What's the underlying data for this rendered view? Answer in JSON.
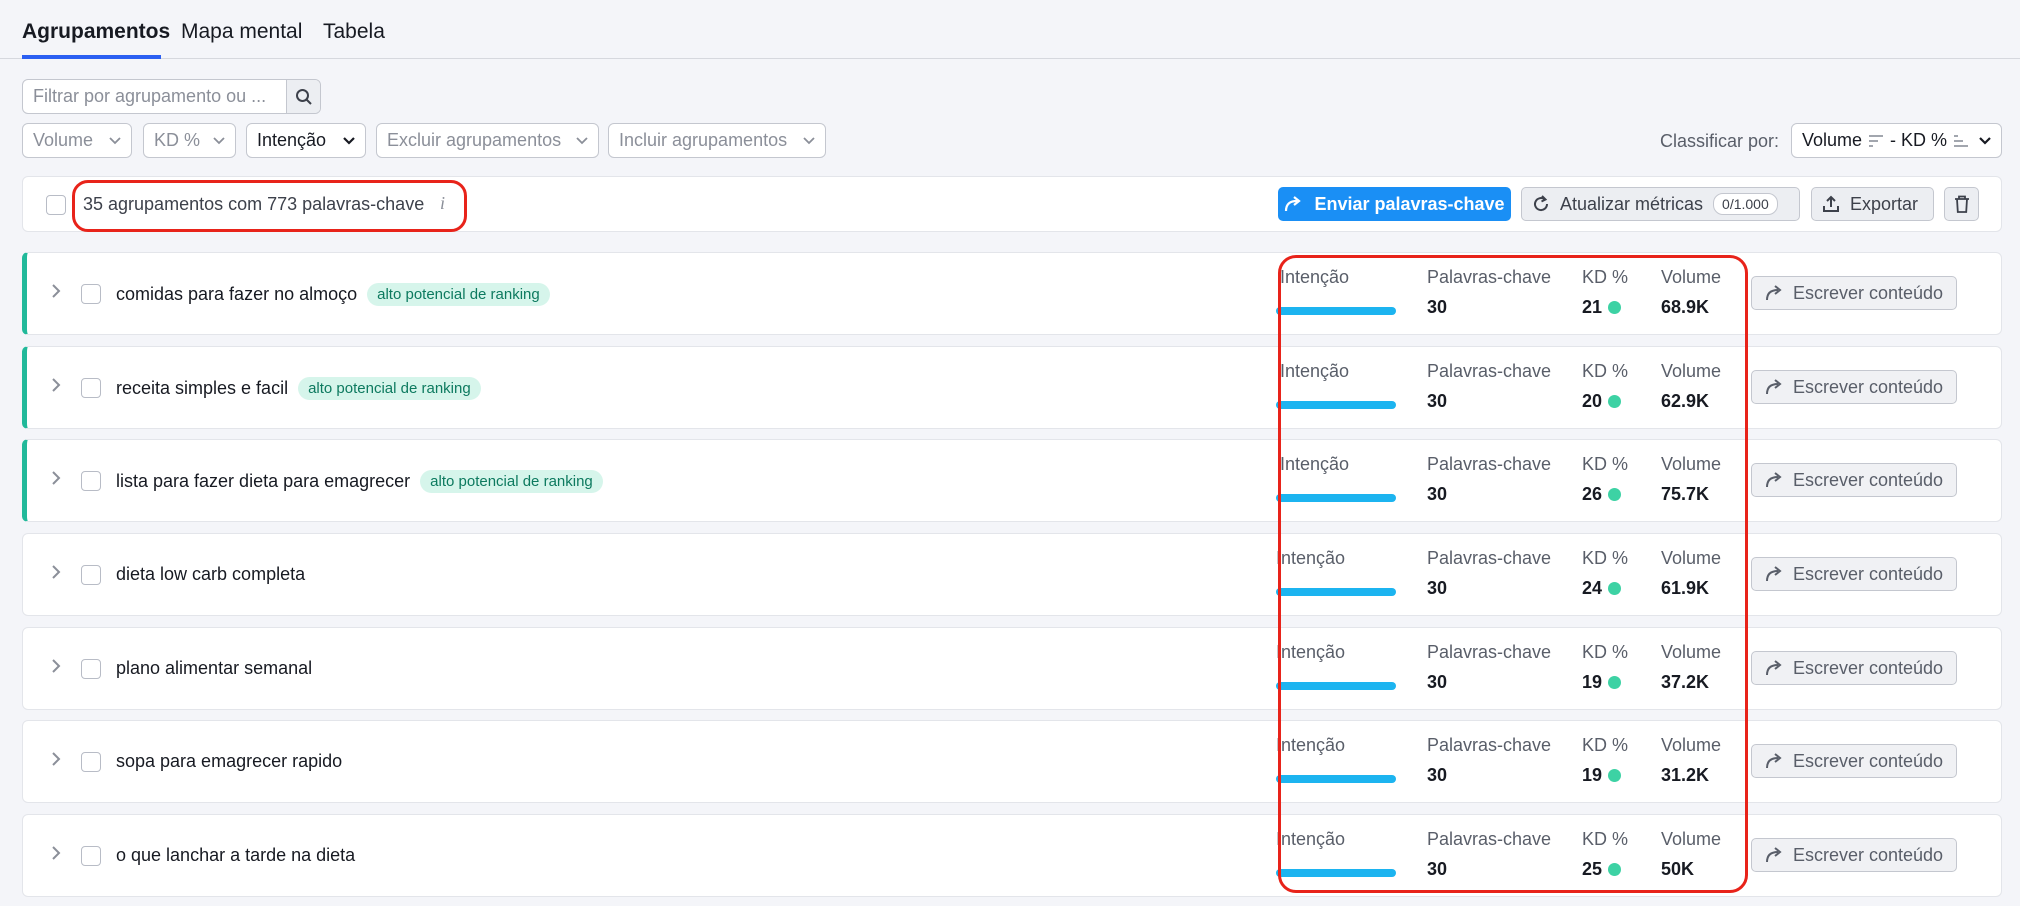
{
  "tabs": [
    "Agrupamentos",
    "Mapa mental",
    "Tabela"
  ],
  "filter": {
    "placeholder": "Filtrar por agrupamento ou ..."
  },
  "dropdowns": {
    "volume": "Volume",
    "kd": "KD %",
    "intencao": "Intenção",
    "excluir": "Excluir agrupamentos",
    "incluir": "Incluir agrupamentos"
  },
  "sort": {
    "label": "Classificar por:",
    "volume": "Volume",
    "sep": "- KD %"
  },
  "summary": {
    "text": "35 agrupamentos com 773 palavras-chave",
    "info": "i"
  },
  "actions": {
    "send": "Enviar palavras-chave",
    "update": "Atualizar métricas",
    "update_count": "0/1.000",
    "export": "Exportar"
  },
  "metric_labels": {
    "intent": "Intenção",
    "keywords": "Palavras-chave",
    "kd": "KD %",
    "volume": "Volume"
  },
  "write_label": "Escrever conteúdo",
  "badge_label": "alto potencial de ranking",
  "colors": {
    "primary": "#1a8ff5",
    "accent": "#21b99a",
    "intent_bar": "#1cb4f0",
    "kd_dot": "#3dd2a4",
    "highlight": "#e8231a"
  },
  "rows": [
    {
      "title": "comidas para fazer no almoço",
      "badge": true,
      "keywords": "30",
      "kd": "21",
      "volume": "68.9K"
    },
    {
      "title": "receita simples e facil",
      "badge": true,
      "keywords": "30",
      "kd": "20",
      "volume": "62.9K"
    },
    {
      "title": "lista para fazer dieta para emagrecer",
      "badge": true,
      "keywords": "30",
      "kd": "26",
      "volume": "75.7K"
    },
    {
      "title": "dieta low carb completa",
      "badge": false,
      "keywords": "30",
      "kd": "24",
      "volume": "61.9K"
    },
    {
      "title": "plano alimentar semanal",
      "badge": false,
      "keywords": "30",
      "kd": "19",
      "volume": "37.2K"
    },
    {
      "title": "sopa para emagrecer rapido",
      "badge": false,
      "keywords": "30",
      "kd": "19",
      "volume": "31.2K"
    },
    {
      "title": "o que lanchar a tarde na dieta",
      "badge": false,
      "keywords": "30",
      "kd": "25",
      "volume": "50K"
    }
  ]
}
